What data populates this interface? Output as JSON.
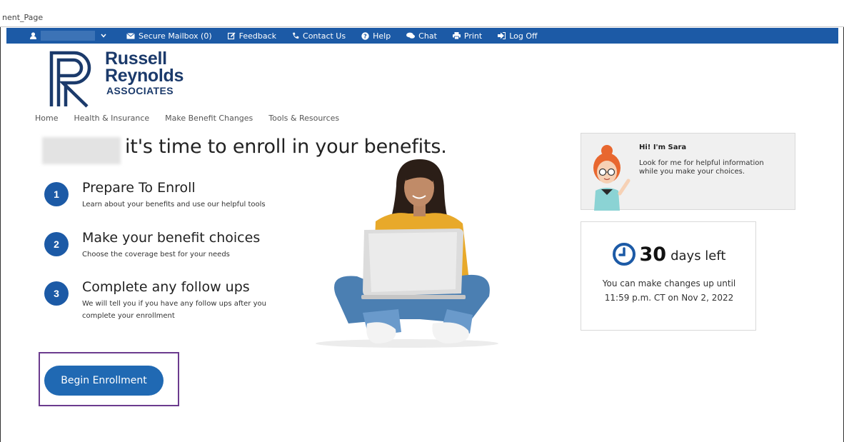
{
  "window": {
    "title": "nent_Page"
  },
  "topbar": {
    "items": [
      {
        "label": "Secure Mailbox (0)",
        "icon": "envelope-icon"
      },
      {
        "label": "Feedback",
        "icon": "edit-icon"
      },
      {
        "label": "Contact Us",
        "icon": "phone-icon"
      },
      {
        "label": "Help",
        "icon": "help-circle-icon"
      },
      {
        "label": "Chat",
        "icon": "chat-icon"
      },
      {
        "label": "Print",
        "icon": "print-icon"
      },
      {
        "label": "Log Off",
        "icon": "logoff-icon"
      }
    ]
  },
  "logo": {
    "line1": "Russell",
    "line2": "Reynolds",
    "line3": "ASSOCIATES"
  },
  "nav": {
    "items": [
      "Home",
      "Health & Insurance",
      "Make Benefit Changes",
      "Tools & Resources"
    ]
  },
  "hero": {
    "headline": "it's time to enroll in your benefits."
  },
  "steps": [
    {
      "num": "1",
      "title": "Prepare To Enroll",
      "desc": [
        "Learn about your benefits and use our helpful tools"
      ]
    },
    {
      "num": "2",
      "title": "Make your benefit choices",
      "desc": [
        "Choose the coverage best for your needs"
      ]
    },
    {
      "num": "3",
      "title": "Complete any follow ups",
      "desc": [
        "We will tell you if you have any follow ups after you",
        "complete your enrollment"
      ]
    }
  ],
  "begin_button": {
    "label": "Begin Enrollment"
  },
  "assistant": {
    "title": "Hi! I'm Sara",
    "text": "Look for me for helpful information while you make your choices."
  },
  "deadline": {
    "days": "30",
    "days_label": "days left",
    "line1": "You can make changes up until",
    "line2": "11:59 p.m. CT on Nov 2, 2022"
  },
  "colors": {
    "brand_blue": "#1c5aa6",
    "logo_navy": "#1b3a6b",
    "highlight_purple": "#6b3b8e"
  }
}
